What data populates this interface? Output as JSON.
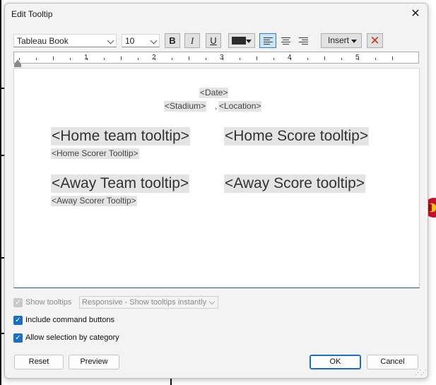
{
  "dialog": {
    "title": "Edit Tooltip",
    "close_glyph": "✕"
  },
  "toolbar": {
    "font_family": "Tableau Book",
    "font_size": "10",
    "bold_label": "B",
    "italic_label": "I",
    "underline_label": "U",
    "text_color": "#2b2b2b",
    "alignment": "left",
    "insert_label": "Insert",
    "clear_glyph": "✕"
  },
  "ruler": {
    "numbers": [
      "1",
      "2",
      "3",
      "4",
      "5"
    ]
  },
  "editor": {
    "date": "<Date>",
    "stadium": "<Stadium>",
    "separator": ",",
    "location": "<Location>",
    "home_team": "<Home team tooltip>",
    "home_score": "<Home Score tooltip>",
    "home_scorer": "<Home Scorer Tooltip>",
    "away_team": "<Away Team tooltip>",
    "away_score": "<Away Score tooltip>",
    "away_scorer": "<Away Scorer Tooltip>"
  },
  "options": {
    "show_tooltips": {
      "label": "Show tooltips",
      "checked": true,
      "disabled": true
    },
    "tooltip_mode": "Responsive - Show tooltips instantly",
    "include_command_buttons": {
      "label": "Include command buttons",
      "checked": true
    },
    "allow_selection": {
      "label": "Allow selection by category",
      "checked": true
    }
  },
  "buttons": {
    "reset": "Reset",
    "preview": "Preview",
    "ok": "OK",
    "cancel": "Cancel"
  },
  "colors": {
    "accent": "#1a6fc4",
    "token_bg": "#e4e4e4",
    "clear_red": "#c0392b"
  }
}
